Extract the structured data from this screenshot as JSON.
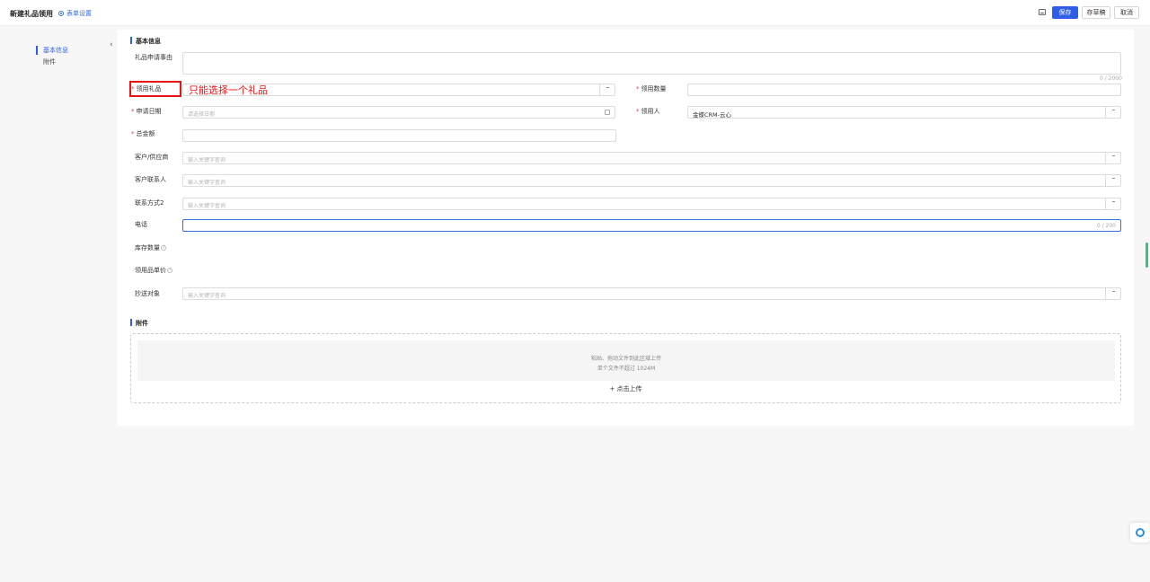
{
  "header": {
    "title": "新建礼品领用",
    "form_settings": "表单设置",
    "save": "保存",
    "draft": "存草稿",
    "cancel": "取消"
  },
  "sidebar": {
    "items": [
      {
        "label": "基本信息",
        "active": true
      },
      {
        "label": "附件",
        "active": false
      }
    ]
  },
  "sections": {
    "basic": "基本信息",
    "attachment": "附件"
  },
  "fields": {
    "reason": {
      "label": "礼品申请事由",
      "counter": "0 / 2000"
    },
    "gift": {
      "label": "领用礼品",
      "required": true
    },
    "quantity": {
      "label": "领用数量",
      "required": true
    },
    "apply_date": {
      "label": "申请日期",
      "required": true,
      "placeholder": "请选择日期"
    },
    "recipient": {
      "label": "领用人",
      "required": true,
      "value": "金蝶CRM-云心"
    },
    "total_amount": {
      "label": "总金额",
      "required": true
    },
    "customer_supplier": {
      "label": "客户/供应商",
      "placeholder": "输入关键字查询"
    },
    "customer_contact": {
      "label": "客户联系人",
      "placeholder": "输入关键字查询"
    },
    "contact_method2": {
      "label": "联系方式2",
      "placeholder": "输入关键字查询"
    },
    "phone": {
      "label": "电话",
      "counter": "0 / 200"
    },
    "stock_qty": {
      "label": "库存数量"
    },
    "unit_price": {
      "label": "领用品单价"
    },
    "cc": {
      "label": "抄送对象",
      "placeholder": "输入关键字查询"
    }
  },
  "annotation": "只能选择一个礼品",
  "upload": {
    "line1": "粘贴、拖动文件到此区域上传",
    "line2": "单个文件不超过 1024M",
    "click": "点击上传"
  },
  "colors": {
    "primary": "#2f5ee8",
    "required": "#ee3333",
    "annotation": "#ee1111"
  }
}
